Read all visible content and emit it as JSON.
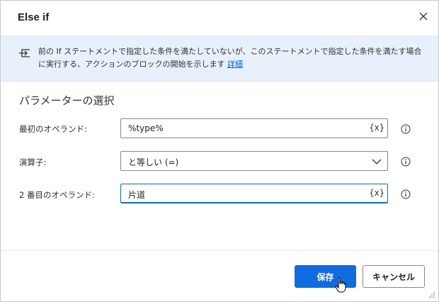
{
  "dialog": {
    "title": "Else if",
    "close_icon": "close-icon"
  },
  "info": {
    "icon": "branch-arrow-icon",
    "text": "前の If ステートメントで指定した条件を満たしていないが、このステートメントで指定した条件を満たす場合に実行する、アクションのブロックの開始を示します",
    "link": "詳細"
  },
  "parameters": {
    "section_title": "パラメーターの選択",
    "first_operand": {
      "label": "最初のオペランド:",
      "value": "%type%",
      "var_button": "{x}"
    },
    "operator": {
      "label": "演算子:",
      "value": "と等しい (=)"
    },
    "second_operand": {
      "label": "2 番目のオペランド:",
      "value": "片道",
      "var_button": "{x}"
    }
  },
  "footer": {
    "save_label": "保存",
    "cancel_label": "キャンセル"
  },
  "colors": {
    "accent": "#0f6cdf",
    "info_background": "#e8f1fb",
    "link": "#0066cc"
  }
}
